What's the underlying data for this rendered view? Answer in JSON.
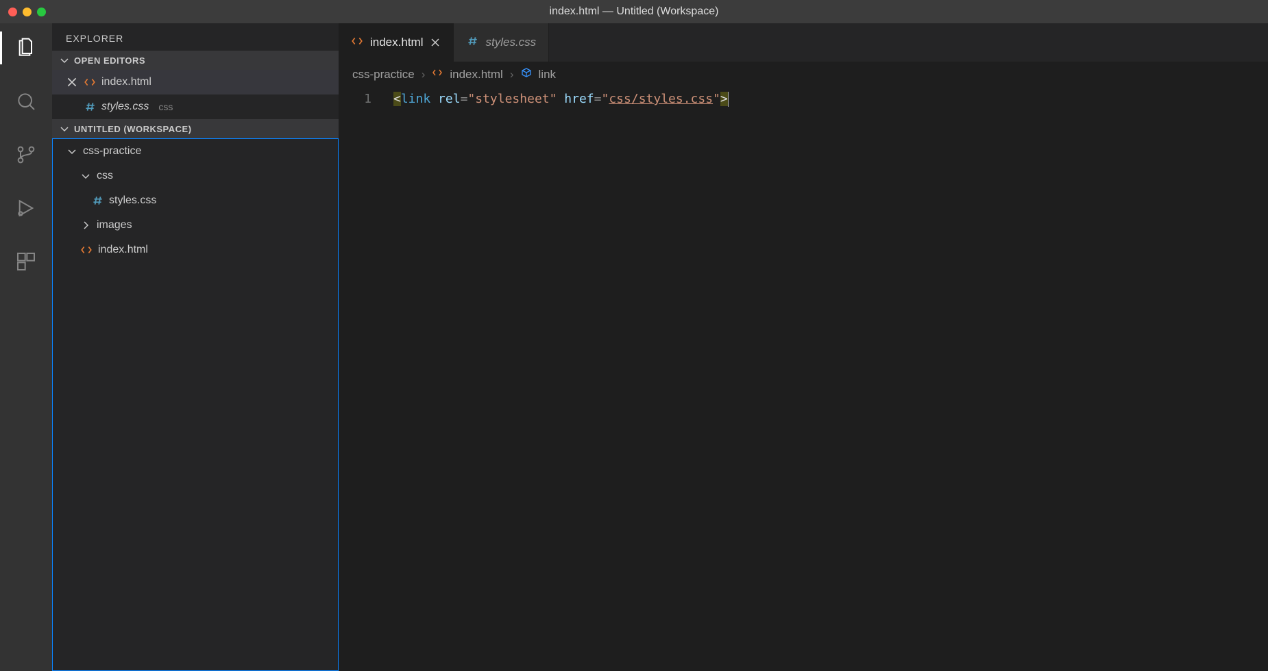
{
  "titlebar": {
    "title": "index.html — Untitled (Workspace)"
  },
  "sidebar": {
    "title": "EXPLORER",
    "open_editors_label": "OPEN EDITORS",
    "open_editors": [
      {
        "name": "index.html",
        "icon": "html-icon",
        "active": true
      },
      {
        "name": "styles.css",
        "icon": "hash-icon",
        "italic": true,
        "badge": "css"
      }
    ],
    "workspace_label": "UNTITLED (WORKSPACE)",
    "tree": {
      "root": "css-practice",
      "nodes": [
        {
          "name": "css",
          "type": "folder",
          "expanded": true,
          "children": [
            {
              "name": "styles.css",
              "type": "file",
              "icon": "hash-icon"
            }
          ]
        },
        {
          "name": "images",
          "type": "folder",
          "expanded": false
        },
        {
          "name": "index.html",
          "type": "file",
          "icon": "html-icon"
        }
      ]
    }
  },
  "tabs": [
    {
      "name": "index.html",
      "icon": "html-icon",
      "active": true,
      "closeable": true
    },
    {
      "name": "styles.css",
      "icon": "hash-icon",
      "active": false,
      "italic": true
    }
  ],
  "breadcrumbs": {
    "parts": [
      "css-practice",
      "index.html",
      "link"
    ]
  },
  "editor": {
    "line_number": "1",
    "code": {
      "tag": "link",
      "attr1_name": "rel",
      "attr1_eq": "=",
      "attr1_val": "\"stylesheet\"",
      "attr2_name": "href",
      "attr2_eq": "=",
      "attr2_q": "\"",
      "attr2_link": "css/styles.css",
      "attr2_q2": "\""
    }
  }
}
